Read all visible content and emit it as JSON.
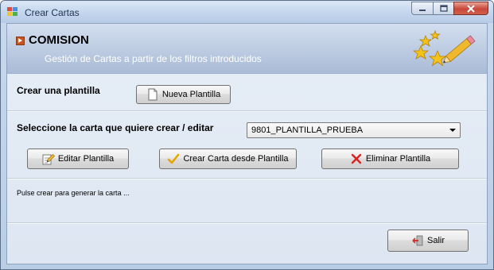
{
  "window": {
    "title": "Crear Cartas",
    "minimize_icon": "minimize-icon",
    "maximize_icon": "maximize-icon",
    "close_icon": "close-icon"
  },
  "header": {
    "title": "COMISION",
    "subtitle": "Gestión de Cartas a partir de los filtros introducidos",
    "bullet_icon": "orange-bullet-icon",
    "art_icon": "stars-pencil-icon"
  },
  "template": {
    "label": "Crear una plantilla",
    "new_button": "Nueva Plantilla"
  },
  "letter": {
    "label": "Seleccione la carta que quiere crear / editar",
    "selected": "9801_PLANTILLA_PRUEBA"
  },
  "actions": {
    "edit_button": "Editar Plantilla",
    "create_button": "Crear Carta desde Plantilla",
    "delete_button": "Eliminar Plantilla"
  },
  "status_text": "Pulse crear para generar la carta ...",
  "exit_button": "Salir",
  "colors": {
    "header_subtitle": "#ffffff",
    "delete_icon": "#e02020",
    "check_icon": "#e8a400"
  }
}
